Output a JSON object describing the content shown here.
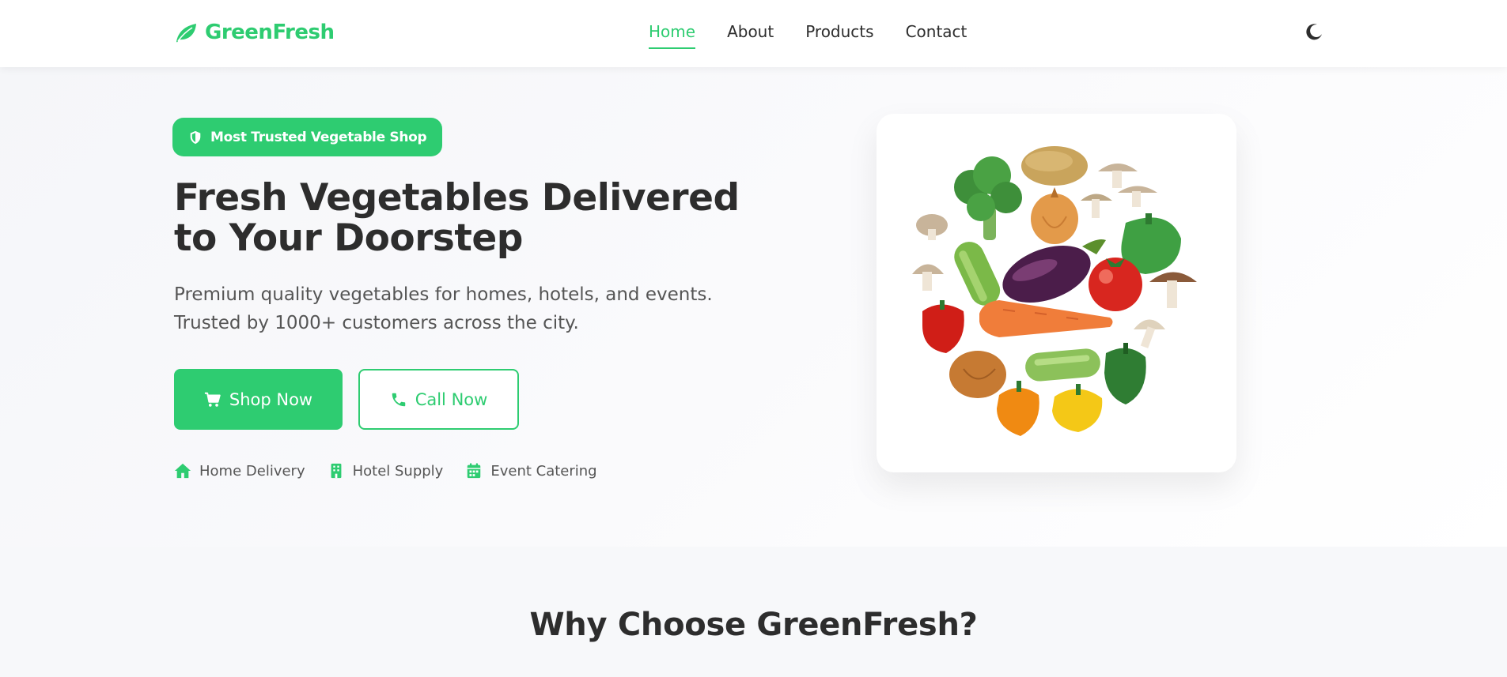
{
  "brand": {
    "name": "GreenFresh",
    "color": "#2ecc71",
    "icon": "leaf-icon"
  },
  "nav": {
    "items": [
      {
        "label": "Home",
        "active": true
      },
      {
        "label": "About",
        "active": false
      },
      {
        "label": "Products",
        "active": false
      },
      {
        "label": "Contact",
        "active": false
      }
    ],
    "theme_toggle_icon": "moon-icon"
  },
  "hero": {
    "badge": {
      "label": "Most Trusted Vegetable Shop",
      "icon": "shield-icon"
    },
    "title": "Fresh Vegetables Delivered to Your Doorstep",
    "subtitle": "Premium quality vegetables for homes, hotels, and events. Trusted by 1000+ customers across the city.",
    "buttons": {
      "shop": {
        "label": "Shop Now",
        "icon": "cart-icon"
      },
      "call": {
        "label": "Call Now",
        "icon": "phone-icon"
      }
    },
    "features": [
      {
        "label": "Home Delivery",
        "icon": "home-icon"
      },
      {
        "label": "Hotel Supply",
        "icon": "building-icon"
      },
      {
        "label": "Event Catering",
        "icon": "calendar-icon"
      }
    ],
    "image_alt": "vegetables-illustration"
  },
  "why": {
    "title": "Why Choose GreenFresh?"
  },
  "colors": {
    "accent": "#2ecc71",
    "text": "#2d2d2d",
    "muted": "#555555"
  }
}
